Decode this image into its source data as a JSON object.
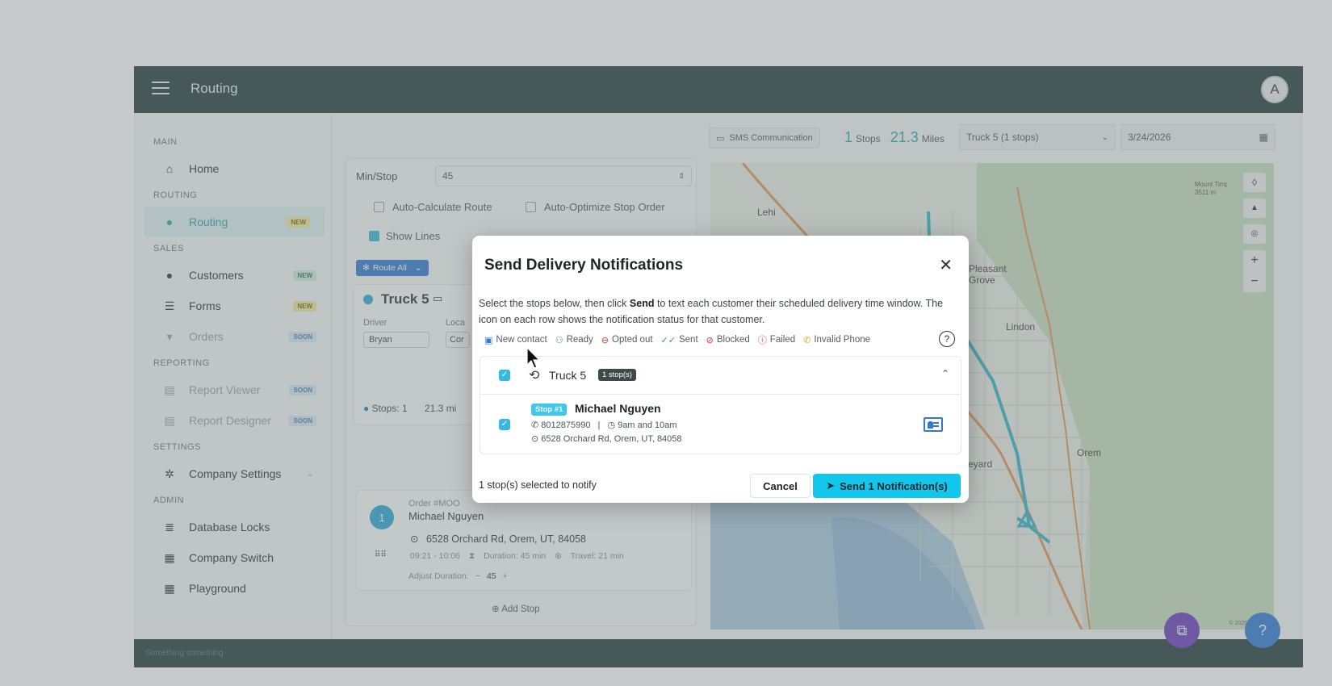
{
  "app": {
    "title": "Routing",
    "avatar_letter": "A",
    "footer_text": "Something something"
  },
  "sidebar": {
    "sections": {
      "main": "MAIN",
      "routing": "ROUTING",
      "sales": "SALES",
      "reporting": "REPORTING",
      "settings": "SETTINGS",
      "admin": "ADMIN"
    },
    "items": {
      "home": "Home",
      "routing": "Routing",
      "routing_badge": "NEW",
      "customers": "Customers",
      "customers_badge": "NEW",
      "forms": "Forms",
      "forms_badge": "NEW",
      "orders": "Orders",
      "orders_badge": "SOON",
      "report_viewer": "Report Viewer",
      "report_viewer_badge": "SOON",
      "report_designer": "Report Designer",
      "report_designer_badge": "SOON",
      "company_settings": "Company Settings",
      "database_locks": "Database Locks",
      "company_switch": "Company Switch",
      "playground": "Playground"
    }
  },
  "toolbar": {
    "sms": "SMS Communication",
    "stops_count": "1",
    "stops_label": "Stops",
    "miles_value": "21.3",
    "miles_label": "Miles",
    "truck_select": "Truck 5 (1 stops)",
    "date": "3/24/2026"
  },
  "left_panel": {
    "min_stop_label": "Min/Stop",
    "min_stop_value": "45",
    "auto_calc": "Auto-Calculate Route",
    "auto_optimize": "Auto-Optimize Stop Order",
    "show_lines": "Show Lines",
    "route_all": "Route All",
    "truck_name": "Truck 5",
    "driver_label": "Driver",
    "driver_value": "Bryan",
    "location_label": "Loca",
    "location_value": "Cor",
    "stops_summary": "Stops: 1",
    "miles_summary": "21.3 mi",
    "order_no": "Order #MOO",
    "order_customer": "Michael Nguyen",
    "order_address": "6528 Orchard Rd, Orem, UT, 84058",
    "order_time": "09:21 - 10:06",
    "order_duration": "Duration: 45 min",
    "order_travel": "Travel: 21 min",
    "adjust_duration_label": "Adjust Duration:",
    "adjust_duration_value": "45",
    "add_stop": "Add Stop",
    "stop_number": "1"
  },
  "map": {
    "labels": [
      "Lehi",
      "Pleasant Grove",
      "Lindon",
      "Orem",
      "Vineyard"
    ],
    "peak": "Mount Timpanogos",
    "peak_elev": "3511 m",
    "copyright": "© 2025 Mapbox"
  },
  "modal": {
    "title": "Send Delivery Notifications",
    "desc_part1": "Select the stops below, then click ",
    "desc_bold": "Send",
    "desc_part2": " to text each customer their scheduled delivery time window. The icon on each row shows the notification status for that customer.",
    "legend": {
      "new_contact": "New contact",
      "ready": "Ready",
      "opted_out": "Opted out",
      "sent": "Sent",
      "blocked": "Blocked",
      "failed": "Failed",
      "invalid_phone": "Invalid Phone"
    },
    "group": {
      "name": "Truck 5",
      "count": "1 stop(s)"
    },
    "stop": {
      "tag": "Stop #1",
      "customer": "Michael Nguyen",
      "phone": "8012875990",
      "window": "9am and 10am",
      "address": "6528 Orchard Rd, Orem, UT, 84058"
    },
    "footer_note": "1 stop(s) selected to notify",
    "cancel": "Cancel",
    "send": "Send 1 Notification(s)"
  },
  "colors": {
    "topbar": "#233c3b",
    "accent": "#12c6ec",
    "teal": "#2aa6a5"
  }
}
